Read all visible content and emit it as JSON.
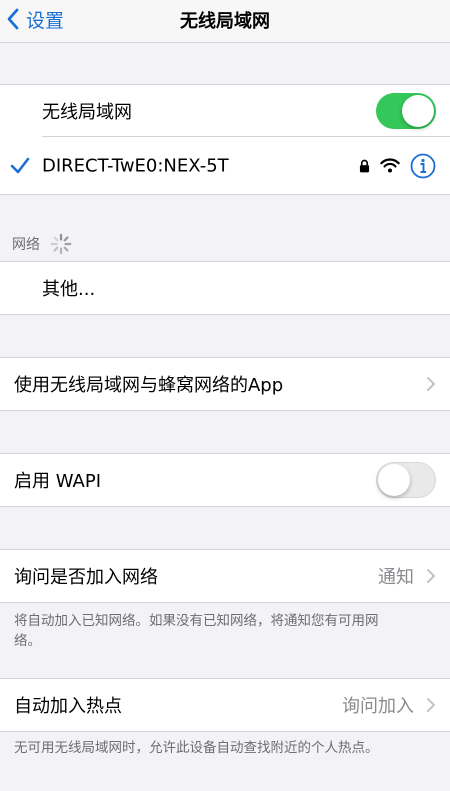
{
  "nav": {
    "back_label": "设置",
    "title": "无线局域网"
  },
  "wlan": {
    "toggle_label": "无线局域网",
    "toggle_on": true,
    "connected_network": "DIRECT-TwE0:NEX-5T"
  },
  "networks": {
    "header": "网络",
    "other_label": "其他..."
  },
  "apps": {
    "label": "使用无线局域网与蜂窝网络的App"
  },
  "wapi": {
    "label": "启用 WAPI",
    "toggle_on": false
  },
  "ask_join": {
    "label": "询问是否加入网络",
    "value": "通知",
    "footer": "将自动加入已知网络。如果没有已知网络，将通知您有可用网络。"
  },
  "hotspot": {
    "label": "自动加入热点",
    "value": "询问加入",
    "footer": "无可用无线局域网时，允许此设备自动查找附近的个人热点。"
  },
  "colors": {
    "accent": "#1a6fd6",
    "toggle_on": "#34c759",
    "toggle_off": "#e9e9ea",
    "secondary_text": "#8a8a8e"
  }
}
